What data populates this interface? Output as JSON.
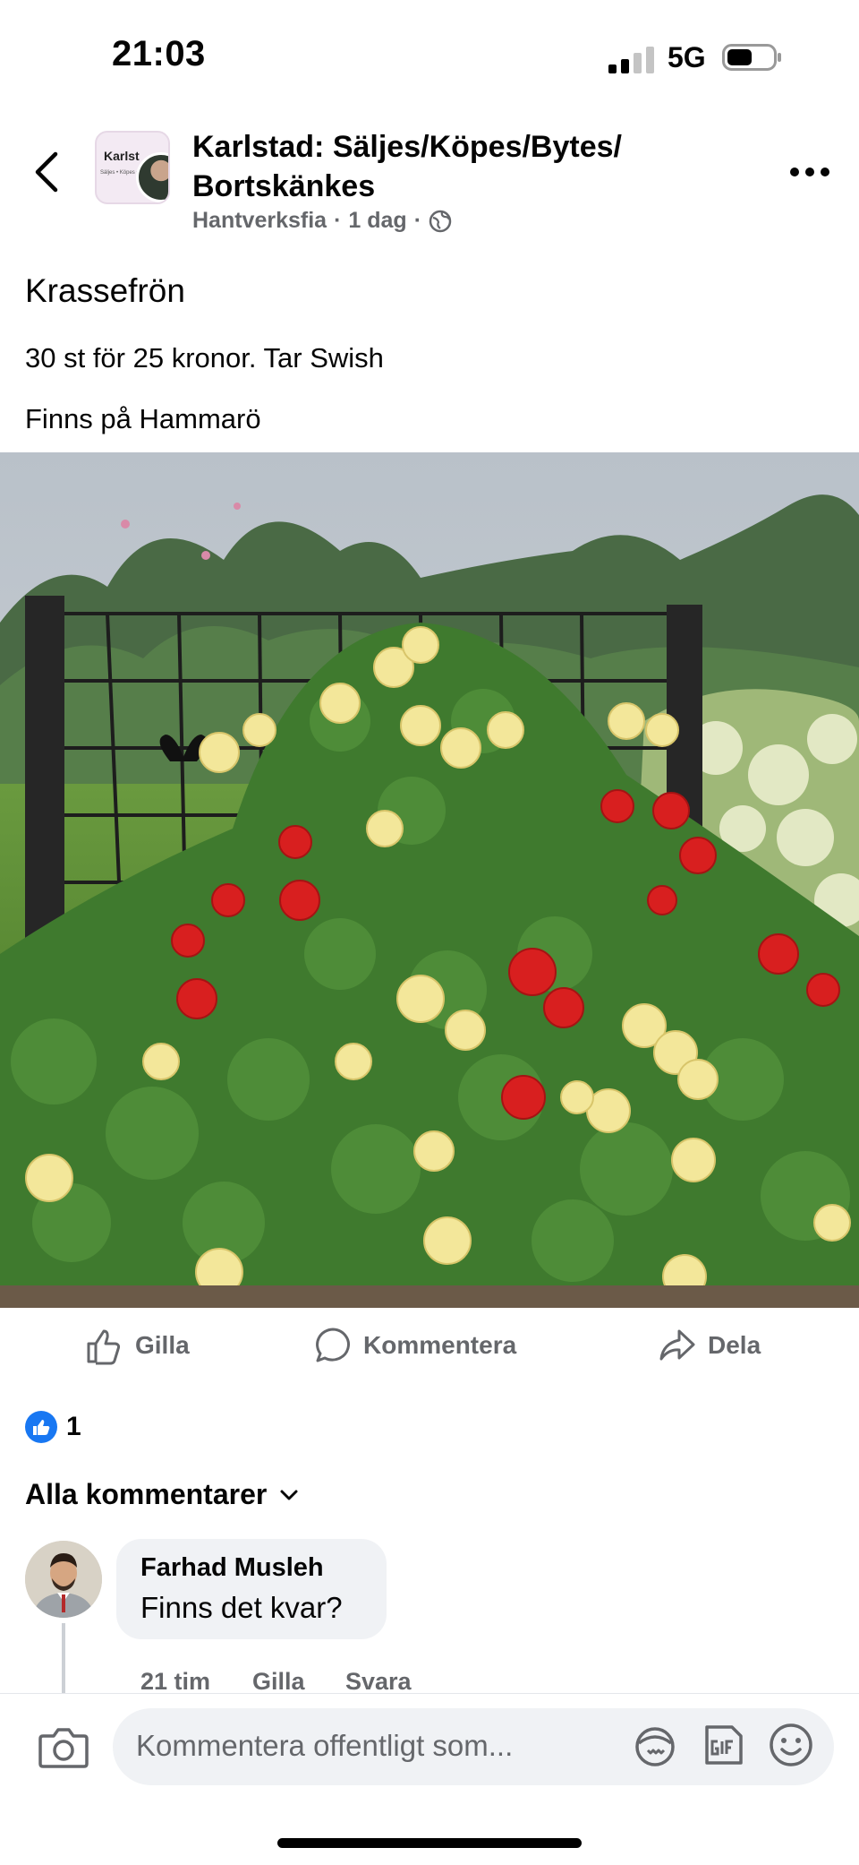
{
  "status_bar": {
    "time": "21:03",
    "network": "5G"
  },
  "header": {
    "group_name": "Karlstad: Säljes/Köpes/Bytes/ Bortskänkes",
    "avatar_text": "Karlst",
    "avatar_subtext": "Säljes • Köpes • Bytes",
    "author": "Hantverksfia",
    "sep1": "·",
    "time": "1 dag",
    "sep2": "·"
  },
  "post": {
    "title": "Krassefrön",
    "line1": "30 st för 25 kronor. Tar Swish",
    "line2": "Finns på Hammarö"
  },
  "actions": {
    "like": "Gilla",
    "comment": "Kommentera",
    "share": "Dela"
  },
  "reactions": {
    "count": "1"
  },
  "comments_filter": "Alla kommentarer",
  "comment": {
    "author": "Farhad Musleh",
    "text": "Finns det kvar?",
    "time": "21 tim",
    "like": "Gilla",
    "reply": "Svara"
  },
  "composer": {
    "placeholder": "Kommentera offentligt som..."
  },
  "colors": {
    "accent": "#1877f2",
    "secondary_text": "#65676b",
    "bubble_bg": "#f0f2f5"
  }
}
